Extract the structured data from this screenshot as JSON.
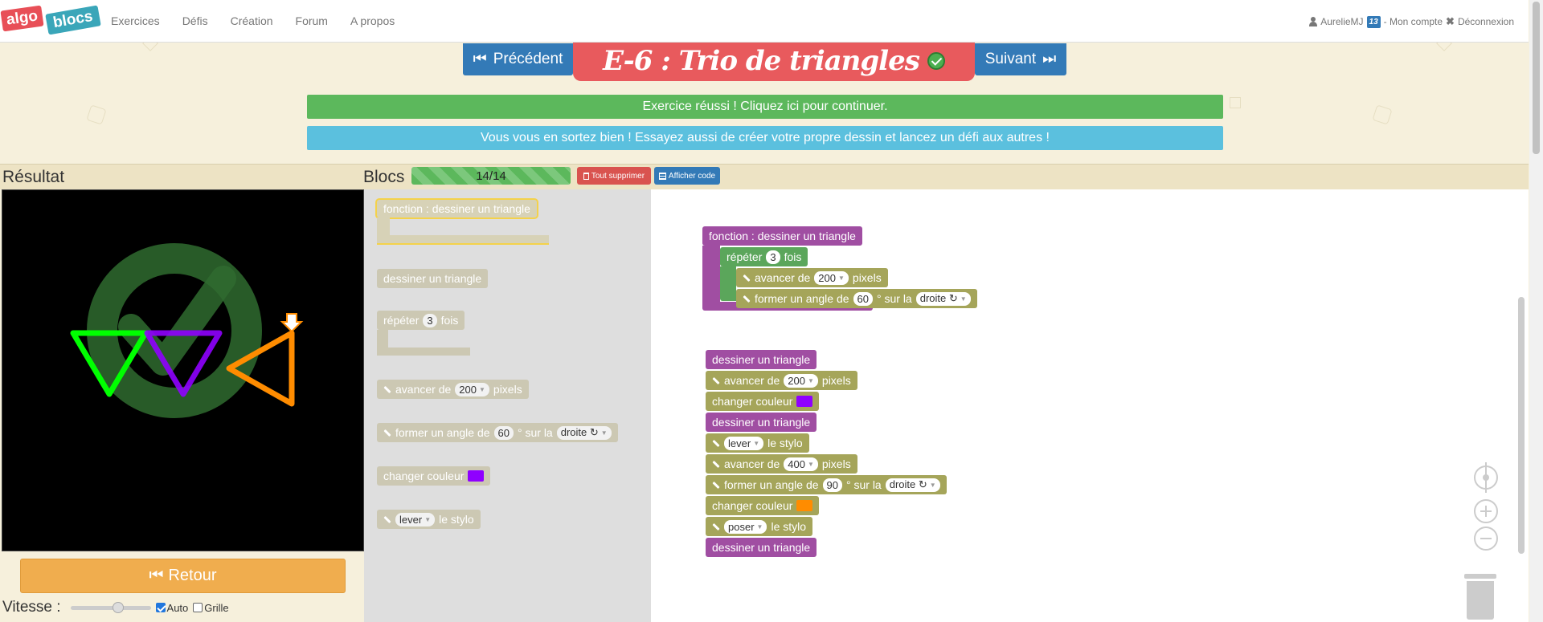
{
  "nav": {
    "logo_algo": "algo",
    "logo_blocs": "blocs",
    "links": [
      "Exercices",
      "Défis",
      "Création",
      "Forum",
      "A propos"
    ],
    "username": "AurelieMJ",
    "badge": "13",
    "account": "- Mon compte",
    "logout": "Déconnexion"
  },
  "exercise": {
    "prev_label": "Précédent",
    "next_label": "Suivant",
    "title": "E-6 : Trio de triangles",
    "success_msg": "Exercice réussi ! Cliquez ici pour continuer.",
    "info_msg": "Vous vous en sortez bien ! Essayez aussi de créer votre propre dessin et lancez un défi aux autres !"
  },
  "panels": {
    "result_title": "Résultat",
    "blocs_title": "Blocs",
    "block_count": "14/14",
    "delete_all": "Tout supprimer",
    "show_code": "Afficher code"
  },
  "controls": {
    "back_label": "Retour",
    "speed_label": "Vitesse :",
    "speed_value": 0.55,
    "auto_label": "Auto",
    "auto_checked": true,
    "grid_label": "Grille",
    "grid_checked": false
  },
  "toolbox": {
    "fn_def": "fonction : dessiner un triangle",
    "call": "dessiner un triangle",
    "repeat_pre": "répéter",
    "repeat_n": "3",
    "repeat_post": "fois",
    "forward_pre": "avancer de",
    "forward_n": "200",
    "forward_post": "pixels",
    "turn_pre": "former un angle de",
    "turn_n": "60",
    "turn_mid": "° sur la",
    "turn_dir": "droite ↻",
    "color_label": "changer couleur",
    "color_value": "#8f00ff",
    "pen_value": "lever",
    "pen_post": "le stylo"
  },
  "workspace": {
    "fn_def": "fonction : dessiner un triangle",
    "repeat_pre": "répéter",
    "repeat_n": "3",
    "repeat_post": "fois",
    "fn_forward_pre": "avancer de",
    "fn_forward_n": "200",
    "fn_forward_post": "pixels",
    "fn_turn_pre": "former un angle de",
    "fn_turn_n": "60",
    "fn_turn_mid": "° sur la",
    "fn_turn_dir": "droite ↻",
    "call1": "dessiner un triangle",
    "fwd1_pre": "avancer de",
    "fwd1_n": "200",
    "fwd1_post": "pixels",
    "color1_label": "changer couleur",
    "color1_value": "#8f00ff",
    "call2": "dessiner un triangle",
    "pen1_value": "lever",
    "pen1_post": "le stylo",
    "fwd2_pre": "avancer de",
    "fwd2_n": "400",
    "fwd2_post": "pixels",
    "turn2_pre": "former un angle de",
    "turn2_n": "90",
    "turn2_mid": "° sur la",
    "turn2_dir": "droite ↻",
    "color2_label": "changer couleur",
    "color2_value": "#ff8c00",
    "pen2_value": "poser",
    "pen2_post": "le stylo",
    "call3": "dessiner un triangle"
  },
  "colors": {
    "triangle1": "#00ff00",
    "triangle2": "#8f00ff",
    "triangle3": "#ff8c00",
    "success_ring": "#2f6b2f"
  }
}
